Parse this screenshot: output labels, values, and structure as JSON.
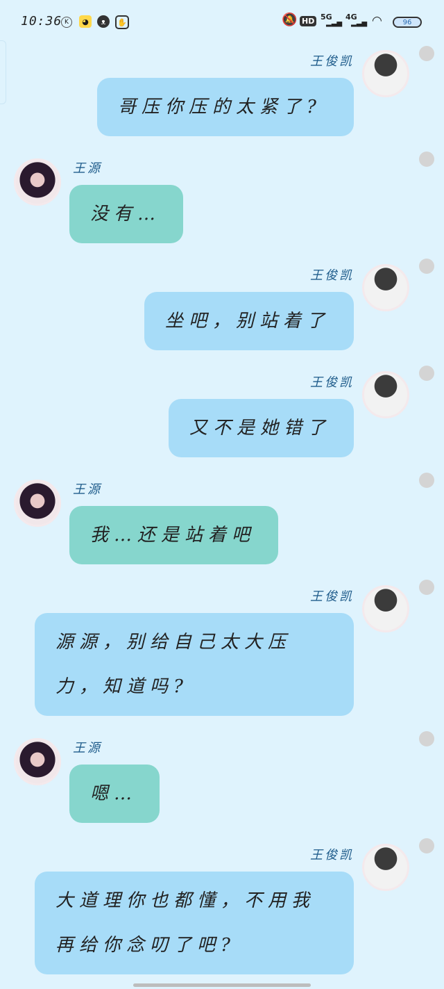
{
  "status_bar": {
    "time": "10:36",
    "network_1": "5G",
    "network_2": "4G",
    "hd": "HD",
    "battery": "96"
  },
  "messages": [
    {
      "sender": "王俊凯",
      "side": "right",
      "lines": [
        "哥压你压的太紧了?"
      ]
    },
    {
      "sender": "王源",
      "side": "left",
      "lines": [
        "没有…"
      ]
    },
    {
      "sender": "王俊凯",
      "side": "right",
      "lines": [
        "坐吧，别站着了"
      ]
    },
    {
      "sender": "王俊凯",
      "side": "right",
      "lines": [
        "又不是她错了"
      ]
    },
    {
      "sender": "王源",
      "side": "left",
      "lines": [
        "我…还是站着吧"
      ]
    },
    {
      "sender": "王俊凯",
      "side": "right",
      "lines": [
        "源源，别给自己太大压",
        "力，知道吗?"
      ]
    },
    {
      "sender": "王源",
      "side": "left",
      "lines": [
        "嗯…"
      ]
    },
    {
      "sender": "王俊凯",
      "side": "right",
      "lines": [
        "大道理你也都懂，不用我",
        "再给你念叨了吧?"
      ]
    }
  ],
  "colors": {
    "background": "#dff3fd",
    "right_bubble": "#a7dcf8",
    "left_bubble": "#86d6cd",
    "name_text": "#1f5c8b"
  },
  "icons": [
    "k-icon",
    "qq-icon",
    "cat-icon",
    "hand-icon",
    "mute-icon",
    "signal-icon",
    "wifi-icon",
    "battery-icon"
  ]
}
